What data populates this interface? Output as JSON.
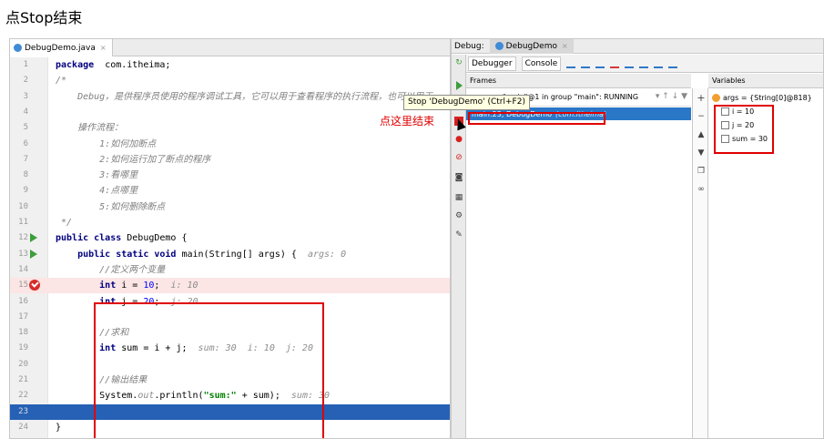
{
  "caption": "点Stop结束",
  "editor": {
    "tab_label": "DebugDemo.java",
    "lines": [
      {
        "n": "1",
        "html_parts": [
          [
            "kw",
            "package"
          ],
          [
            "",
            "  com.itheima;"
          ]
        ]
      },
      {
        "n": "2",
        "html_parts": [
          [
            "cm",
            "/*"
          ]
        ]
      },
      {
        "n": "3",
        "html_parts": [
          [
            "cm",
            "    Debug，是供程序员使用的程序调试工具，它可以用于查看程序的执行流程，也可以用于"
          ]
        ]
      },
      {
        "n": "4",
        "html_parts": []
      },
      {
        "n": "5",
        "html_parts": [
          [
            "cm",
            "    操作流程："
          ]
        ]
      },
      {
        "n": "6",
        "html_parts": [
          [
            "cm",
            "        1:如何加断点"
          ]
        ]
      },
      {
        "n": "7",
        "html_parts": [
          [
            "cm",
            "        2:如何运行加了断点的程序"
          ]
        ]
      },
      {
        "n": "8",
        "html_parts": [
          [
            "cm",
            "        3:看哪里"
          ]
        ]
      },
      {
        "n": "9",
        "html_parts": [
          [
            "cm",
            "        4:点哪里"
          ]
        ]
      },
      {
        "n": "10",
        "html_parts": [
          [
            "cm",
            "        5:如何删除断点"
          ]
        ]
      },
      {
        "n": "11",
        "html_parts": [
          [
            "cm",
            " */"
          ]
        ]
      },
      {
        "n": "12",
        "html_parts": [
          [
            "kw",
            "public class"
          ],
          [
            "",
            " DebugDemo {"
          ]
        ]
      },
      {
        "n": "13",
        "html_parts": [
          [
            "kw",
            "    public static void"
          ],
          [
            "",
            " main(String[] args) {  "
          ],
          [
            "hint",
            "args: 0"
          ]
        ]
      },
      {
        "n": "14",
        "html_parts": [
          [
            "cm",
            "        //定义两个变量"
          ]
        ]
      },
      {
        "n": "15",
        "html_parts": [
          [
            "kw",
            "        int"
          ],
          [
            "",
            " i = "
          ],
          [
            "num",
            "10"
          ],
          [
            "",
            ";  "
          ],
          [
            "hint",
            "i: 10"
          ]
        ]
      },
      {
        "n": "16",
        "html_parts": [
          [
            "kw",
            "        int"
          ],
          [
            "",
            " j = "
          ],
          [
            "num",
            "20"
          ],
          [
            "",
            ";  "
          ],
          [
            "hint",
            "j: 20"
          ]
        ]
      },
      {
        "n": "17",
        "html_parts": []
      },
      {
        "n": "18",
        "html_parts": [
          [
            "cm",
            "        //求和"
          ]
        ]
      },
      {
        "n": "19",
        "html_parts": [
          [
            "kw",
            "        int"
          ],
          [
            "",
            " sum = i + j;  "
          ],
          [
            "hint",
            "sum: 30  i: 10  j: 20"
          ]
        ]
      },
      {
        "n": "20",
        "html_parts": []
      },
      {
        "n": "21",
        "html_parts": [
          [
            "cm",
            "        //输出结果"
          ]
        ]
      },
      {
        "n": "22",
        "html_parts": [
          [
            "",
            "        System."
          ],
          [
            "hint",
            "out"
          ],
          [
            "",
            ".println("
          ],
          [
            "str",
            "\"sum:\""
          ],
          [
            "",
            " + sum);  "
          ],
          [
            "hint",
            "sum: 30"
          ]
        ]
      },
      {
        "n": "23",
        "html_parts": []
      },
      {
        "n": "24",
        "html_parts": [
          [
            "",
            "}"
          ]
        ]
      }
    ]
  },
  "debug": {
    "title": "Debug:",
    "session_tab": "DebugDemo",
    "tab_debugger": "Debugger",
    "tab_console": "Console",
    "frames_label": "Frames",
    "thread": "\"main\"@1 in group \"main\": RUNNING",
    "frame_main": "main:23, DebugDemo",
    "frame_pkg": "(com.itheima)",
    "variables_label": "Variables",
    "vars": [
      {
        "kind": "obj",
        "text": "args = {String[0]@818}"
      },
      {
        "kind": "int",
        "text": "i = 10"
      },
      {
        "kind": "int",
        "text": "j = 20"
      },
      {
        "kind": "int",
        "text": "sum = 30"
      }
    ]
  },
  "tooltip": "Stop 'DebugDemo' (Ctrl+F2)",
  "annotation": "点这里结束"
}
